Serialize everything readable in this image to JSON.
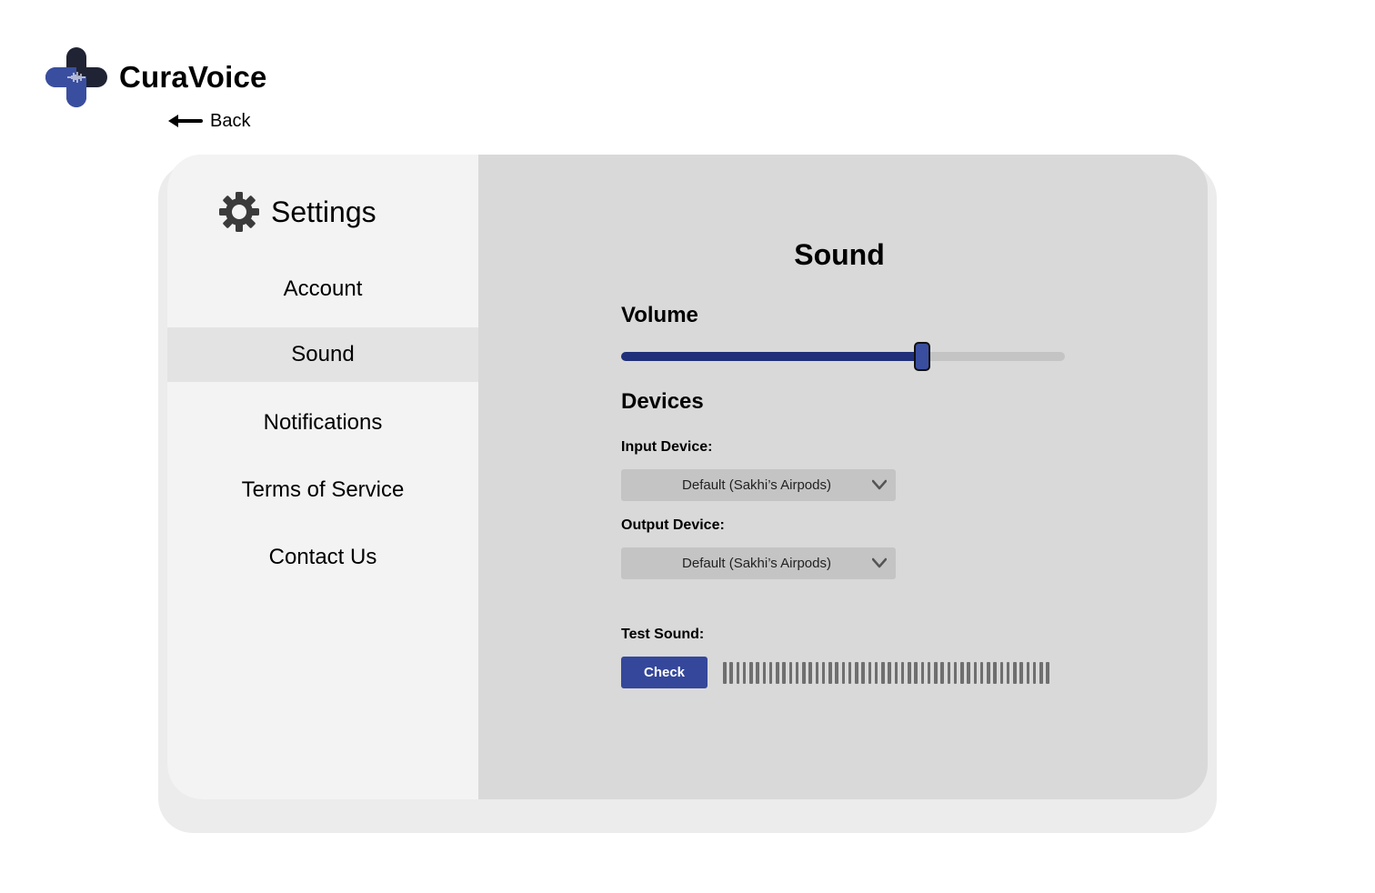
{
  "app": {
    "name": "CuraVoice",
    "colors": {
      "brand_dark": "#1f2333",
      "brand_blue": "#3a4ea0",
      "accent": "#34479a",
      "slider_fill": "#1f2f7a"
    }
  },
  "nav": {
    "back_label": "Back",
    "back_icon": "arrow-left-icon"
  },
  "sidebar": {
    "title": "Settings",
    "title_icon": "gear-icon",
    "items": [
      {
        "label": "Account",
        "active": false
      },
      {
        "label": "Sound",
        "active": true
      },
      {
        "label": "Notifications",
        "active": false
      },
      {
        "label": "Terms of Service",
        "active": false
      },
      {
        "label": "Contact Us",
        "active": false
      }
    ]
  },
  "sound": {
    "title": "Sound",
    "volume": {
      "label": "Volume",
      "value_fraction": 0.675
    },
    "devices": {
      "label": "Devices",
      "input": {
        "label": "Input Device:",
        "value": "Default (Sakhi’s Airpods)"
      },
      "output": {
        "label": "Output Device:",
        "value": "Default (Sakhi’s Airpods)"
      }
    },
    "test": {
      "label": "Test Sound:",
      "button_label": "Check",
      "meter_segments": 50
    }
  }
}
